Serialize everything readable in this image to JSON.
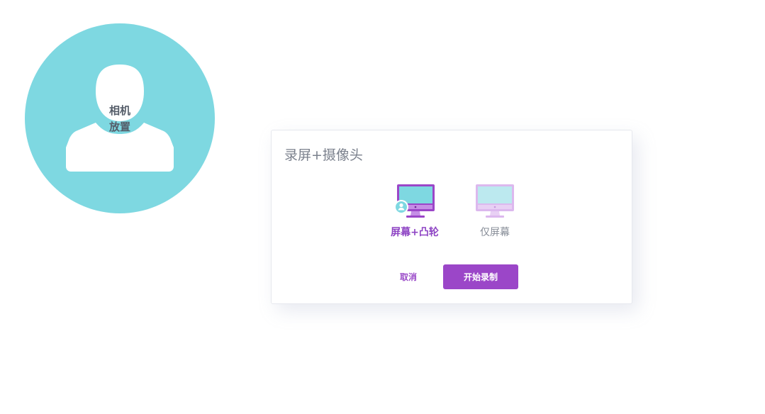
{
  "camera": {
    "label_line1": "相机",
    "label_line2": "放置",
    "color": "#7ed8e1"
  },
  "dialog": {
    "title": "录屏+摄像头",
    "options": [
      {
        "label": "屏幕+凸轮",
        "icon": "monitor-with-avatar-icon",
        "selected": true
      },
      {
        "label": "仅屏幕",
        "icon": "monitor-icon",
        "selected": false
      }
    ],
    "cancel_label": "取消",
    "start_label": "开始录制"
  },
  "colors": {
    "accent": "#9b46c8",
    "camera": "#7ed8e1",
    "title_text": "#7b818d"
  }
}
